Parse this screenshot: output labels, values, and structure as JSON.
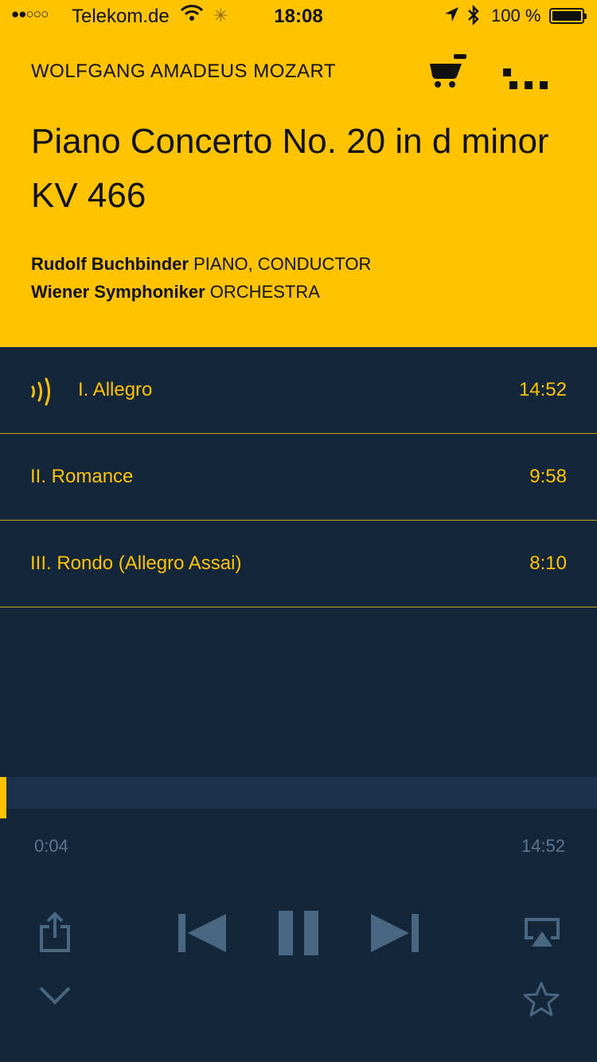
{
  "status_bar": {
    "signal": "●●○○○",
    "carrier": "Telekom.de",
    "wifi_icon": "wifi-icon",
    "activity_icon": "activity-icon",
    "time": "18:08",
    "location_icon": "location-arrow-icon",
    "bluetooth_icon": "bluetooth-icon",
    "battery_percent": "100 %",
    "battery_level": 1.0
  },
  "header": {
    "composer": "WOLFGANG AMADEUS MOZART",
    "title": "Piano Concerto No. 20 in d minor KV 466",
    "cart_icon": "cart-icon",
    "more_icon": "more-icon",
    "credits": [
      {
        "name": "Rudolf Buchbinder",
        "role": "PIANO, CONDUCTOR"
      },
      {
        "name": "Wiener Symphoniker",
        "role": "ORCHESTRA"
      }
    ]
  },
  "tracks": [
    {
      "title": "I. Allegro",
      "duration": "14:52",
      "playing": true
    },
    {
      "title": "II. Romance",
      "duration": "9:58",
      "playing": false
    },
    {
      "title": "III. Rondo (Allegro Assai)",
      "duration": "8:10",
      "playing": false
    }
  ],
  "player": {
    "elapsed": "0:04",
    "total": "14:52",
    "progress_fraction": 0.0045,
    "controls": {
      "share": "share-icon",
      "previous": "previous-icon",
      "pause": "pause-icon",
      "next": "next-icon",
      "airplay": "airplay-icon",
      "collapse": "chevron-down-icon",
      "favorite": "star-icon"
    }
  },
  "colors": {
    "accent": "#ffc300",
    "background": "#13263a",
    "muted": "#5b7590",
    "divider": "#c9a30c"
  }
}
